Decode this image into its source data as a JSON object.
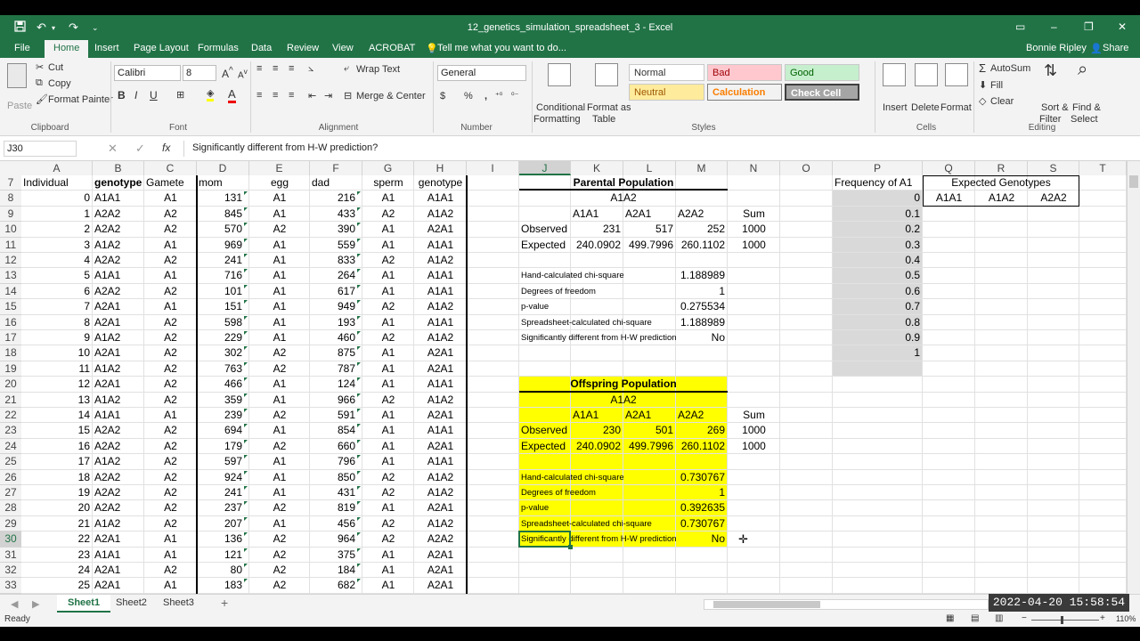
{
  "titlebar": {
    "title": "12_genetics_simulation_spreadsheet_3  -  Excel",
    "save_icon": "save-icon",
    "undo_icon": "undo-icon",
    "redo_icon": "redo-icon",
    "minimize": "–",
    "restore": "❐",
    "close": "✕",
    "options": "▭"
  },
  "tabs": {
    "file": "File",
    "home": "Home",
    "insert": "Insert",
    "page_layout": "Page Layout",
    "formulas": "Formulas",
    "data": "Data",
    "review": "Review",
    "view": "View",
    "acrobat": "ACROBAT",
    "tell_me": "Tell me what you want to do...",
    "user": "Bonnie Ripley",
    "share": "Share"
  },
  "ribbon": {
    "paste": "Paste",
    "cut": "Cut",
    "copy": "Copy",
    "format_painter": "Format Painter",
    "clipboard": "Clipboard",
    "font_name": "Calibri",
    "font_size": "8",
    "bold": "B",
    "italic": "I",
    "underline": "U",
    "font": "Font",
    "wrap_text": "Wrap Text",
    "merge_center": "Merge & Center",
    "alignment": "Alignment",
    "number_format": "General",
    "dollar": "$",
    "percent": "%",
    "comma": ",",
    "number": "Number",
    "conditional_formatting": "Conditional",
    "conditional_formatting2": "Formatting",
    "format_as_table": "Format as",
    "format_as_table2": "Table",
    "style_normal": "Normal",
    "style_bad": "Bad",
    "style_good": "Good",
    "style_neutral": "Neutral",
    "style_calculation": "Calculation",
    "style_check": "Check Cell",
    "styles": "Styles",
    "insert": "Insert",
    "delete": "Delete",
    "format": "Format",
    "cells": "Cells",
    "autosum": "AutoSum",
    "fill": "Fill",
    "clear": "Clear",
    "sort_filter": "Sort &",
    "sort_filter2": "Filter",
    "find_select": "Find &",
    "find_select2": "Select",
    "editing": "Editing"
  },
  "formula_bar": {
    "name_box": "J30",
    "cancel": "✕",
    "enter": "✓",
    "fx": "fx",
    "formula": "Significantly different from H-W prediction?"
  },
  "columns": [
    "A",
    "B",
    "C",
    "D",
    "E",
    "F",
    "G",
    "H",
    "I",
    "J",
    "K",
    "L",
    "M",
    "N",
    "O",
    "P",
    "Q",
    "R",
    "S",
    "T"
  ],
  "rows": [
    "7",
    "8",
    "9",
    "10",
    "11",
    "12",
    "13",
    "14",
    "15",
    "16",
    "17",
    "18",
    "19",
    "20",
    "21",
    "22",
    "23",
    "24",
    "25",
    "26",
    "27",
    "28",
    "29",
    "30",
    "31",
    "32",
    "33"
  ],
  "table_headers": {
    "individual": "Individual",
    "genotype": "genotype",
    "gamete": "Gamete",
    "mom": "mom",
    "egg": "egg",
    "dad": "dad",
    "sperm": "sperm",
    "genotype2": "genotype"
  },
  "individuals": [
    [
      "0",
      "A1A1",
      "A1",
      "131",
      "A1",
      "216",
      "A1",
      "A1A1"
    ],
    [
      "1",
      "A2A2",
      "A2",
      "845",
      "A1",
      "433",
      "A2",
      "A1A2"
    ],
    [
      "2",
      "A2A2",
      "A2",
      "570",
      "A2",
      "390",
      "A1",
      "A2A1"
    ],
    [
      "3",
      "A1A2",
      "A1",
      "969",
      "A1",
      "559",
      "A1",
      "A1A1"
    ],
    [
      "4",
      "A2A2",
      "A2",
      "241",
      "A1",
      "833",
      "A2",
      "A1A2"
    ],
    [
      "5",
      "A1A1",
      "A1",
      "716",
      "A1",
      "264",
      "A1",
      "A1A1"
    ],
    [
      "6",
      "A2A2",
      "A2",
      "101",
      "A1",
      "617",
      "A1",
      "A1A1"
    ],
    [
      "7",
      "A2A1",
      "A1",
      "151",
      "A1",
      "949",
      "A2",
      "A1A2"
    ],
    [
      "8",
      "A2A1",
      "A2",
      "598",
      "A1",
      "193",
      "A1",
      "A1A1"
    ],
    [
      "9",
      "A1A2",
      "A2",
      "229",
      "A1",
      "460",
      "A2",
      "A1A2"
    ],
    [
      "10",
      "A2A1",
      "A2",
      "302",
      "A2",
      "875",
      "A1",
      "A2A1"
    ],
    [
      "11",
      "A1A2",
      "A2",
      "763",
      "A2",
      "787",
      "A1",
      "A2A1"
    ],
    [
      "12",
      "A2A1",
      "A2",
      "466",
      "A1",
      "124",
      "A1",
      "A1A1"
    ],
    [
      "13",
      "A1A2",
      "A2",
      "359",
      "A1",
      "966",
      "A2",
      "A1A2"
    ],
    [
      "14",
      "A1A1",
      "A1",
      "239",
      "A2",
      "591",
      "A1",
      "A2A1"
    ],
    [
      "15",
      "A2A2",
      "A2",
      "694",
      "A1",
      "854",
      "A1",
      "A1A1"
    ],
    [
      "16",
      "A2A2",
      "A2",
      "179",
      "A2",
      "660",
      "A1",
      "A2A1"
    ],
    [
      "17",
      "A1A2",
      "A2",
      "597",
      "A1",
      "796",
      "A1",
      "A1A1"
    ],
    [
      "18",
      "A2A2",
      "A2",
      "924",
      "A1",
      "850",
      "A2",
      "A1A2"
    ],
    [
      "19",
      "A2A2",
      "A2",
      "241",
      "A1",
      "431",
      "A2",
      "A1A2"
    ],
    [
      "20",
      "A2A2",
      "A2",
      "237",
      "A2",
      "819",
      "A1",
      "A2A1"
    ],
    [
      "21",
      "A1A2",
      "A2",
      "207",
      "A1",
      "456",
      "A2",
      "A1A2"
    ],
    [
      "22",
      "A2A1",
      "A1",
      "136",
      "A2",
      "964",
      "A2",
      "A2A2"
    ],
    [
      "23",
      "A1A1",
      "A1",
      "121",
      "A2",
      "375",
      "A1",
      "A2A1"
    ],
    [
      "24",
      "A2A1",
      "A2",
      "80",
      "A2",
      "184",
      "A1",
      "A2A1"
    ],
    [
      "25",
      "A2A1",
      "A1",
      "183",
      "A2",
      "682",
      "A1",
      "A2A1"
    ]
  ],
  "parental": {
    "title": "Parental Population",
    "a1a2_top": "A1A2",
    "h1": "A1A1",
    "h2": "A2A1",
    "h3": "A2A2",
    "sum_label": "Sum",
    "observed_label": "Observed",
    "expected_label": "Expected",
    "obs": [
      "231",
      "517",
      "252",
      "1000"
    ],
    "exp": [
      "240.0902",
      "499.7996",
      "260.1102",
      "1000"
    ],
    "chi_label": "Hand-calculated chi-square",
    "chi": "1.188989",
    "df_label": "Degrees of freedom",
    "df": "1",
    "p_label": "p-value",
    "p": "0.275534",
    "ss_chi_label": "Spreadsheet-calculated chi-square",
    "ss_chi": "1.188989",
    "sig_label": "Significantly different from H-W prediction?",
    "sig": "No"
  },
  "offspring": {
    "title": "Offspring Population",
    "a1a2_top": "A1A2",
    "h1": "A1A1",
    "h2": "A2A1",
    "h3": "A2A2",
    "sum_label": "Sum",
    "observed_label": "Observed",
    "expected_label": "Expected",
    "obs": [
      "230",
      "501",
      "269",
      "1000"
    ],
    "exp": [
      "240.0902",
      "499.7996",
      "260.1102",
      "1000"
    ],
    "chi_label": "Hand-calculated chi-square",
    "chi": "0.730767",
    "df_label": "Degrees of freedom",
    "df": "1",
    "p_label": "p-value",
    "p": "0.392635",
    "ss_chi_label": "Spreadsheet-calculated chi-square",
    "ss_chi": "0.730767",
    "sig_label": "Significantly different from H-W prediction?",
    "sig": "No"
  },
  "freq": {
    "header": "Frequency of A1",
    "values": [
      "0",
      "0.1",
      "0.2",
      "0.3",
      "0.4",
      "0.5",
      "0.6",
      "0.7",
      "0.8",
      "0.9",
      "1"
    ]
  },
  "expected_genotypes": {
    "header": "Expected Genotypes",
    "a1a1": "A1A1",
    "a1a2": "A1A2",
    "a2a2": "A2A2"
  },
  "sheets": {
    "s1": "Sheet1",
    "s2": "Sheet2",
    "s3": "Sheet3",
    "add": "+"
  },
  "status": {
    "ready": "Ready",
    "zoom": "110%"
  },
  "timestamp": "2022-04-20  15:58:54",
  "colors": {
    "excel_green": "#217346",
    "highlight_yellow": "#ffff00",
    "freq_gray": "#d9d9d9"
  }
}
